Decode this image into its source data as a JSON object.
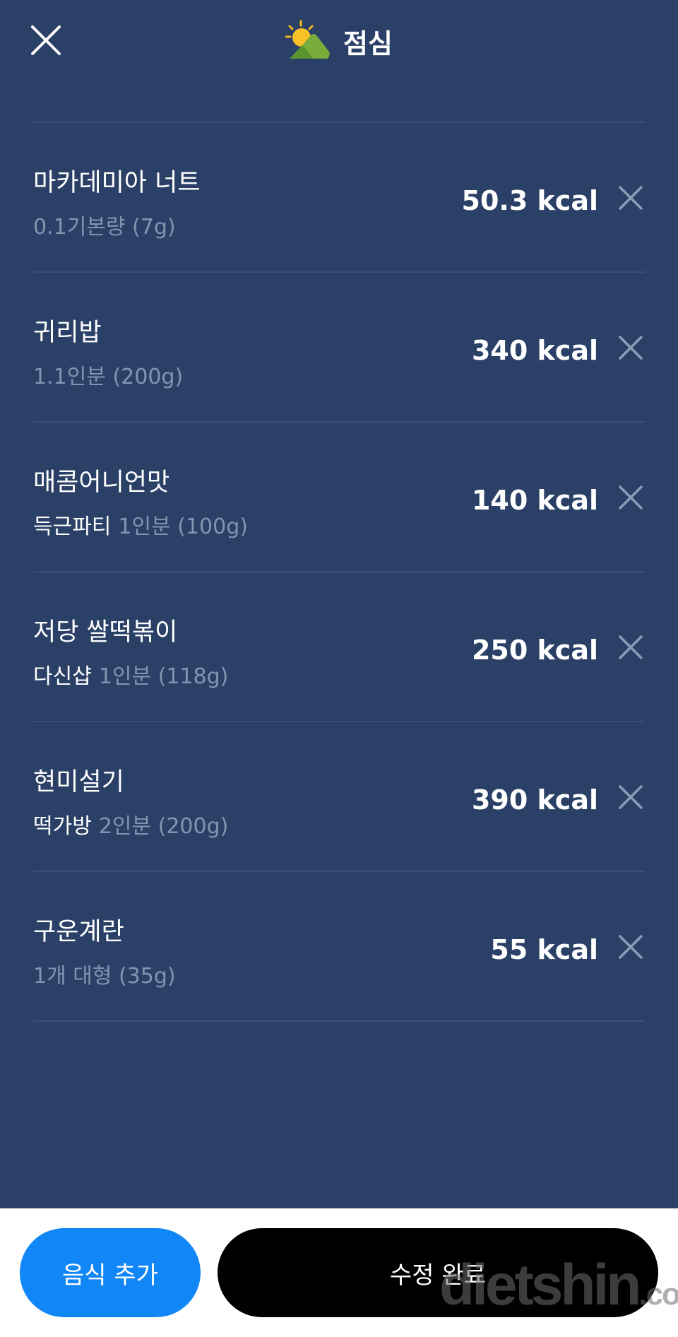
{
  "header": {
    "title": "점심",
    "meal_icon": "sun-behind-hill-icon",
    "close_icon": "close-icon"
  },
  "foods": [
    {
      "name": "마카데미아 너트",
      "brand": "",
      "serving": "0.1기본량 (7g)",
      "kcal": "50.3 kcal"
    },
    {
      "name": "귀리밥",
      "brand": "",
      "serving": "1.1인분 (200g)",
      "kcal": "340 kcal"
    },
    {
      "name": "매콤어니언맛",
      "brand": "득근파티",
      "serving": "1인분 (100g)",
      "kcal": "140 kcal"
    },
    {
      "name": "저당 쌀떡볶이",
      "brand": "다신샵",
      "serving": "1인분 (118g)",
      "kcal": "250 kcal"
    },
    {
      "name": "현미설기",
      "brand": "떡가방",
      "serving": "2인분 (200g)",
      "kcal": "390 kcal"
    },
    {
      "name": "구운계란",
      "brand": "",
      "serving": "1개 대형 (35g)",
      "kcal": "55 kcal"
    }
  ],
  "footer": {
    "add_food_label": "음식 추가",
    "done_label": "수정 완료",
    "watermark_main": "dietshin",
    "watermark_domain": ".com"
  },
  "colors": {
    "background": "#2a4066",
    "primary_button": "#1186f6",
    "done_button": "#000000"
  }
}
